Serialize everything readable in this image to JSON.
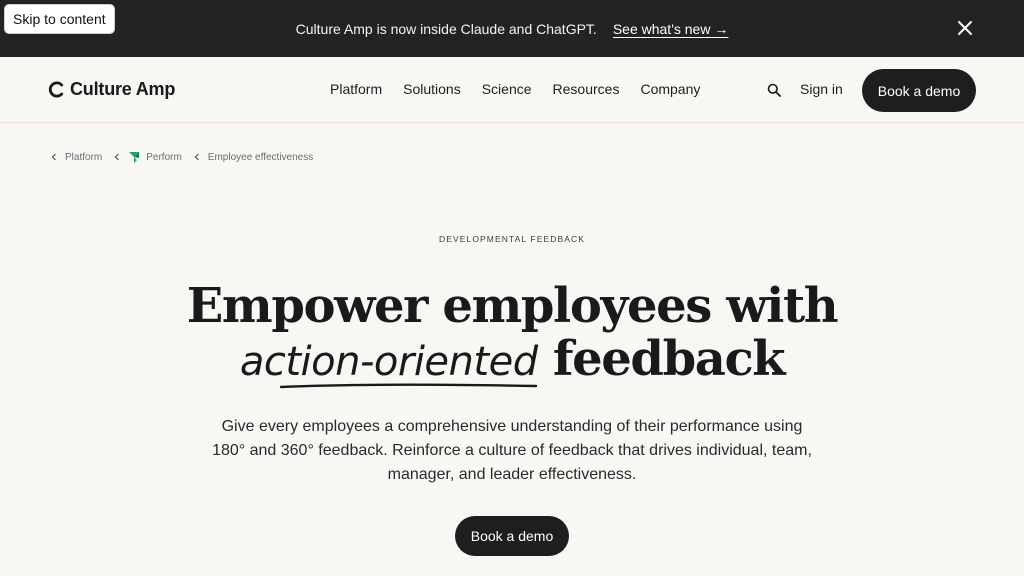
{
  "skip_link": "Skip to content",
  "announcement": {
    "message": "Culture Amp is now inside Claude and ChatGPT.",
    "link": "See what's new →",
    "close_icon": "close-icon"
  },
  "header": {
    "logo_text": "Culture Amp",
    "nav": [
      "Platform",
      "Solutions",
      "Science",
      "Resources",
      "Company"
    ],
    "search_icon": "search-icon",
    "sign_in": "Sign in",
    "cta": "Book a demo"
  },
  "breadcrumb": {
    "items": [
      "Platform",
      "Perform",
      "Employee effectiveness"
    ],
    "perform_icon": "leaf-icon",
    "accent": "#1ea672"
  },
  "hero": {
    "eyebrow": "DEVELOPMENTAL FEEDBACK",
    "title_line1": "Empower employees with",
    "title_highlight": "action-oriented",
    "title_line2_rest": "feedback",
    "description": "Give every employees a comprehensive understanding of their performance using 180° and 360° feedback. Reinforce a culture of feedback that drives individual, team, manager, and leader effectiveness.",
    "cta": "Book a demo"
  },
  "colors": {
    "background": "#f9f7f4",
    "dark": "#1e1e1e",
    "announcement_bg": "#232323"
  }
}
